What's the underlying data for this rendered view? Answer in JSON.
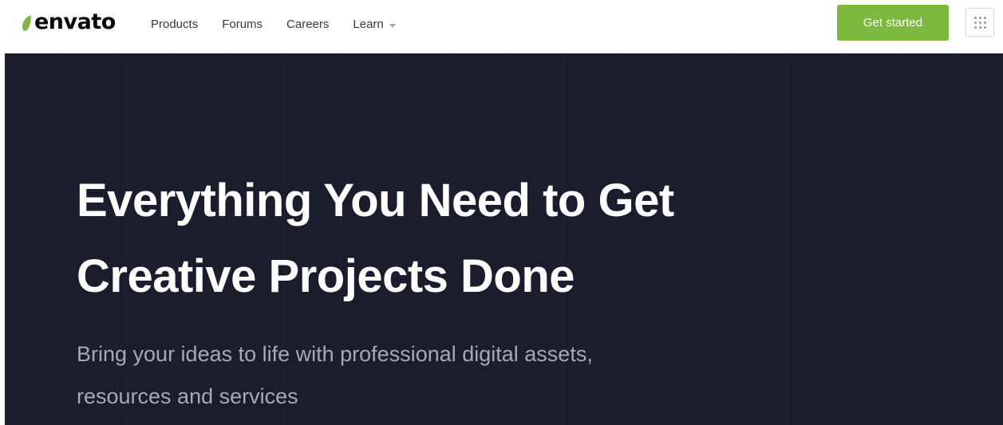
{
  "header": {
    "logo_text": "envato",
    "logo_leaf_color": "#82b541",
    "nav": [
      {
        "label": "Products"
      },
      {
        "label": "Forums"
      },
      {
        "label": "Careers"
      },
      {
        "label": "Learn",
        "has_dropdown": true
      }
    ],
    "cta_label": "Get started",
    "cta_color": "#7eb93f",
    "apps_icon": "grid-icon"
  },
  "hero": {
    "background_color": "#1b1d2c",
    "title_lines": [
      "Everything You Need to Get",
      "Creative Projects Done"
    ],
    "subtitle_lines": [
      "Bring your ideas to life with professional digital assets,",
      "resources and services"
    ]
  }
}
